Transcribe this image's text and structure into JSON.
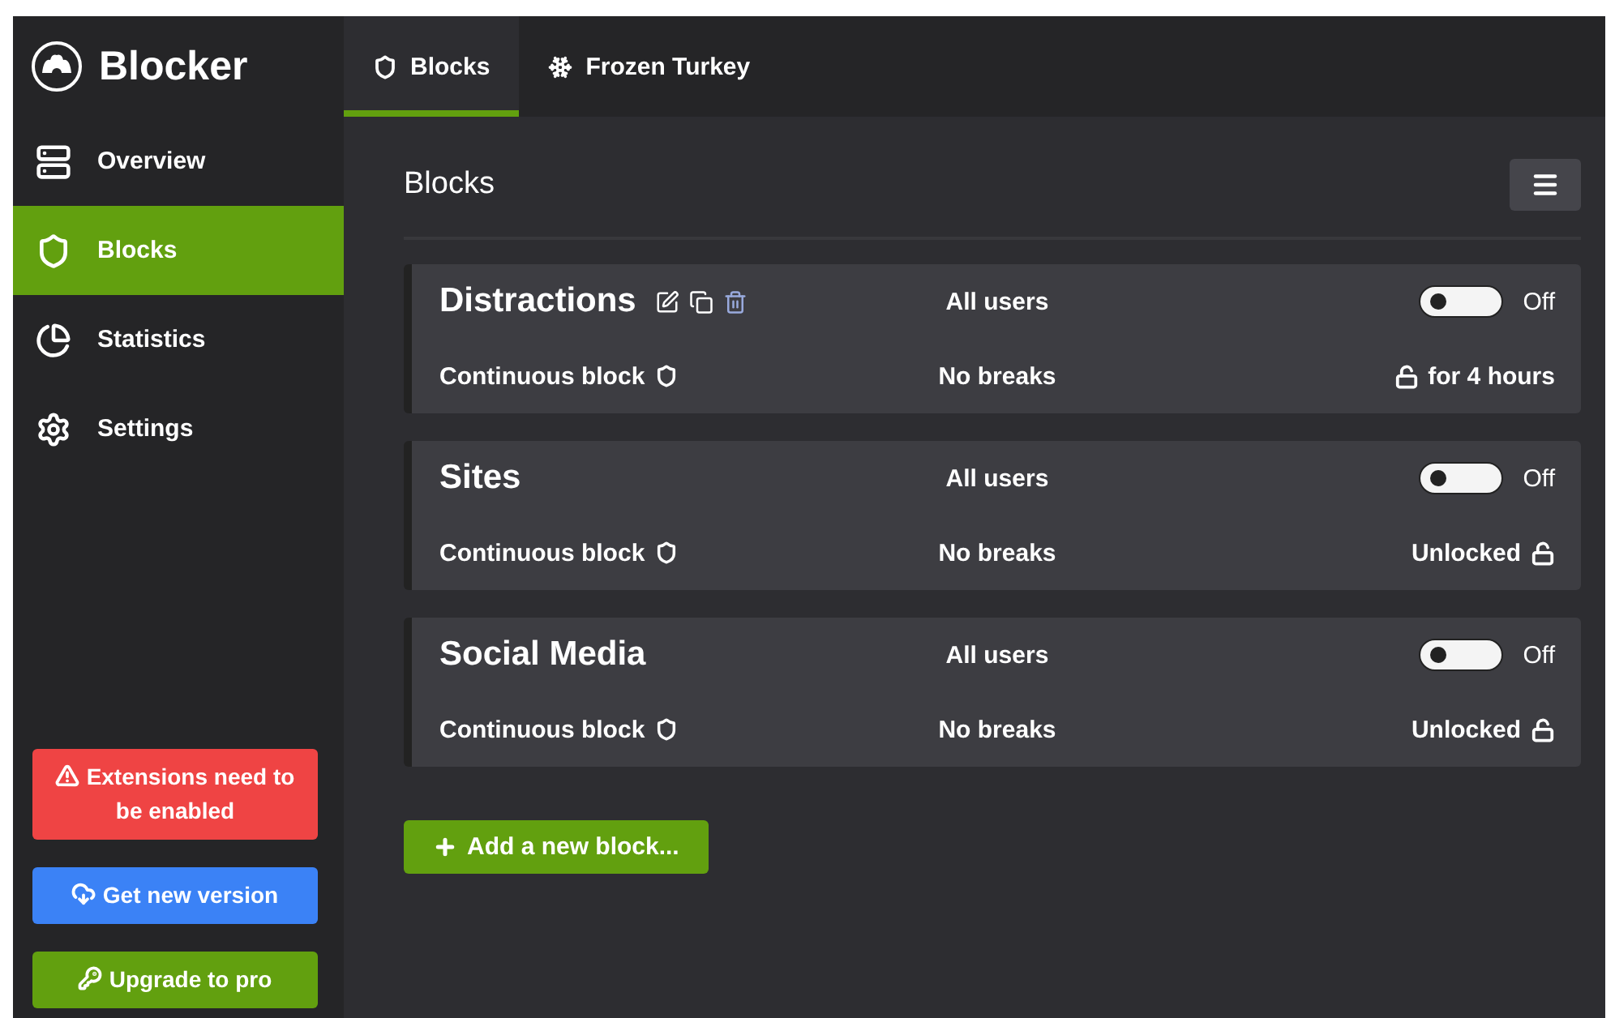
{
  "app": {
    "title": "Blocker"
  },
  "nav": [
    {
      "label": "Overview",
      "selected": false
    },
    {
      "label": "Blocks",
      "selected": true
    },
    {
      "label": "Statistics",
      "selected": false
    },
    {
      "label": "Settings",
      "selected": false
    }
  ],
  "sidebar_buttons": [
    {
      "label": "Extensions need to be enabled",
      "kind": "warning"
    },
    {
      "label": "Get new version",
      "kind": "download"
    },
    {
      "label": "Upgrade to pro",
      "kind": "upgrade"
    }
  ],
  "tabs": [
    {
      "label": "Blocks",
      "selected": true
    },
    {
      "label": "Frozen Turkey",
      "selected": false
    }
  ],
  "page_title": "Blocks",
  "blocks": [
    {
      "name": "Distractions",
      "show_actions": true,
      "users": "All users",
      "type": "Continuous block",
      "breaks": "No breaks",
      "on": false,
      "toggle_label": "Off",
      "lock": {
        "text": "for 4 hours",
        "kind": "timed"
      }
    },
    {
      "name": "Sites",
      "show_actions": false,
      "users": "All users",
      "type": "Continuous block",
      "breaks": "No breaks",
      "on": false,
      "toggle_label": "Off",
      "lock": {
        "text": "Unlocked",
        "kind": "unlocked"
      }
    },
    {
      "name": "Social Media",
      "show_actions": false,
      "users": "All users",
      "type": "Continuous block",
      "breaks": "No breaks",
      "on": false,
      "toggle_label": "Off",
      "lock": {
        "text": "Unlocked",
        "kind": "unlocked"
      }
    }
  ],
  "add_button": "Add a new block..."
}
